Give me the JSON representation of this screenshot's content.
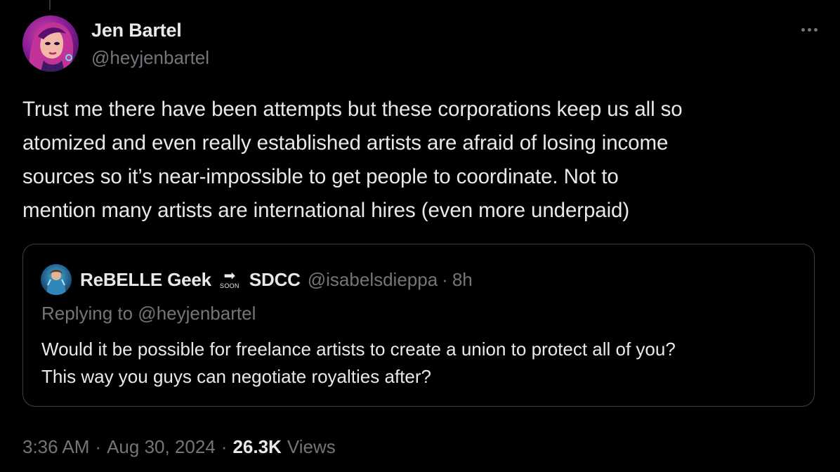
{
  "tweet": {
    "author": {
      "display_name": "Jen Bartel",
      "handle": "@heyjenbartel",
      "avatar_icon": "avatar-illustration-icon"
    },
    "text": "Trust me there have been attempts but these corporations keep us all so\natomized and even really established artists are afraid of losing income\nsources so it’s near-impossible to get people to coordinate. Not to\nmention many artists are international hires (even more underpaid)",
    "time": "3:36 AM",
    "date": "Aug 30, 2024",
    "views_count": "26.3K",
    "views_label": "Views",
    "separator": "·"
  },
  "quote": {
    "author_name": "ReBELLE Geek",
    "emoji_label": "SOON",
    "author_name_suffix": "SDCC",
    "handle": "@isabelsdieppa",
    "separator": "·",
    "time_ago": "8h",
    "replying_to": "Replying to @heyjenbartel",
    "text": "Would it be possible for freelance artists to create a union to protect all of you?\nThis way you guys can negotiate royalties after?"
  },
  "colors": {
    "background": "#000000",
    "primary_text": "#e7e9ea",
    "secondary_text": "#71767b",
    "border": "#3a3d41"
  }
}
